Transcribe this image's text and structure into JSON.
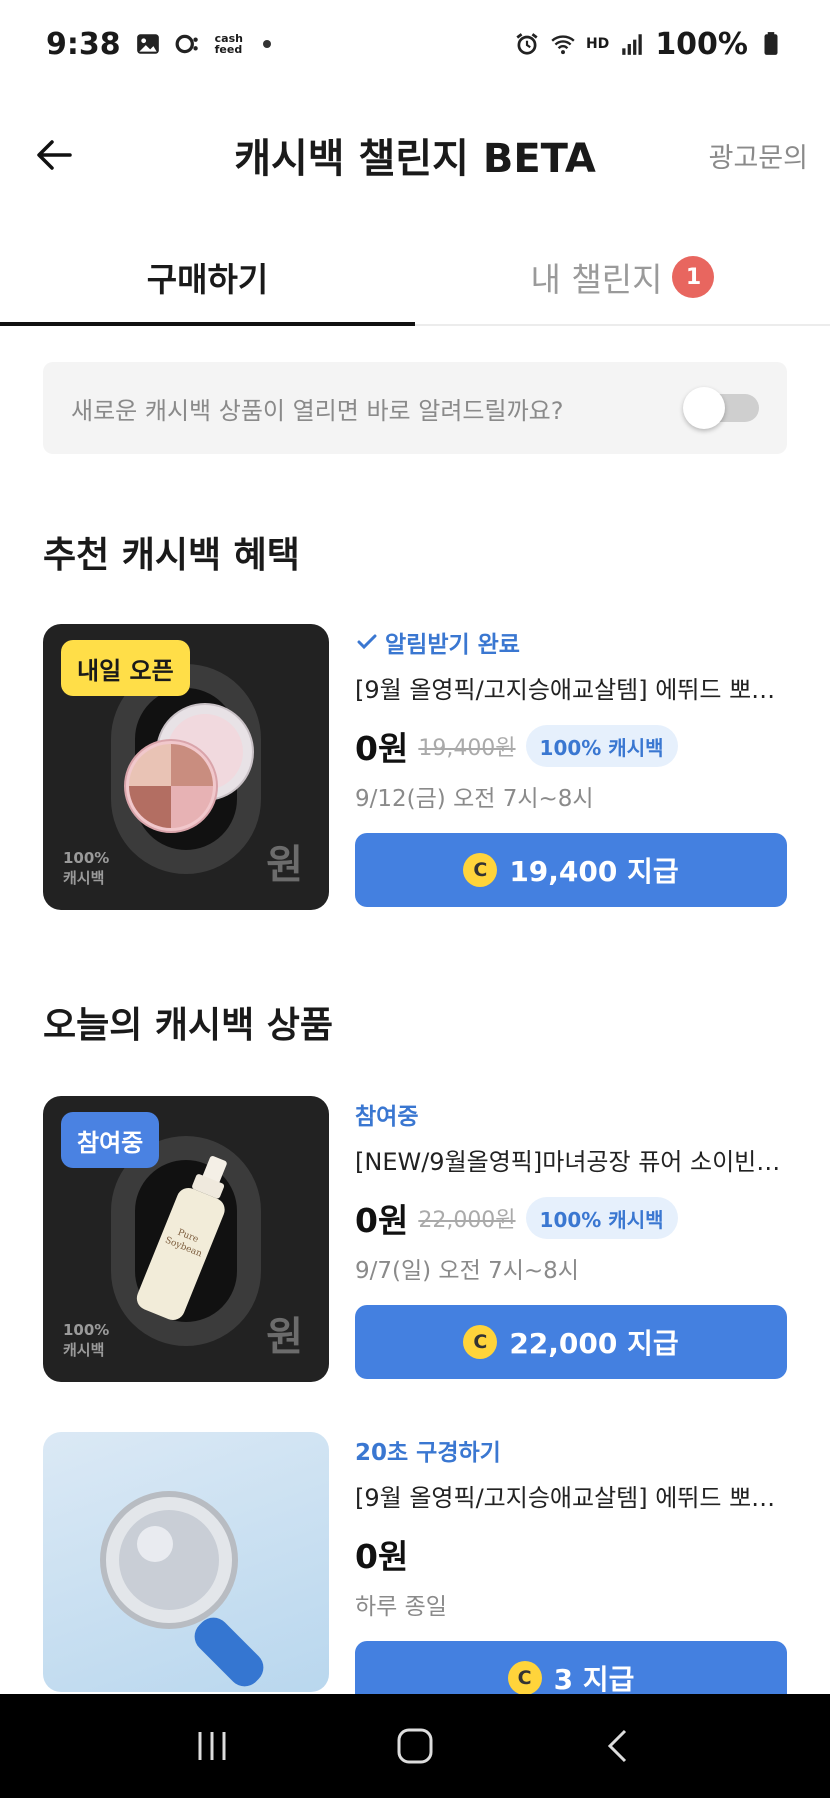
{
  "status_bar": {
    "time": "9:38",
    "cash_label": "cash\nfeed",
    "battery": "100%",
    "hd_label": "HD"
  },
  "header": {
    "title": "캐시백 챌린지 BETA",
    "ad_link": "광고문의"
  },
  "tabs": [
    {
      "label": "구매하기",
      "active": true
    },
    {
      "label": "내 챌린지",
      "badge": "1",
      "active": false
    }
  ],
  "notify": {
    "text": "새로운 캐시백 상품이 열리면 바로 알려드릴까요?",
    "toggle_on": false
  },
  "sections": {
    "recommended": "추천 캐시백 혜택",
    "today": "오늘의 캐시백 상품"
  },
  "products": [
    {
      "thumb_badge": "내일 오픈",
      "thumb_sign": "100%\n캐시백",
      "thumb_won": "원",
      "status": "알림받기 완료",
      "name": "[9월 올영픽/고지승애교살템] 에뛰드 뽀…",
      "price": "0원",
      "original_price": "19,400원",
      "cashback_tag": "100% 캐시백",
      "time": "9/12(금) 오전 7시~8시",
      "button": "19,400 지급",
      "coin": "C"
    },
    {
      "thumb_badge": "참여중",
      "thumb_sign": "100%\n캐시백",
      "thumb_won": "원",
      "status": "참여중",
      "name": "[NEW/9월올영픽]마녀공장 퓨어 소이빈…",
      "price": "0원",
      "original_price": "22,000원",
      "cashback_tag": "100% 캐시백",
      "time": "9/7(일) 오전 7시~8시",
      "button": "22,000 지급",
      "coin": "C"
    },
    {
      "status": "20초 구경하기",
      "name": "[9월 올영픽/고지승애교살템] 에뛰드 뽀…",
      "price": "0원",
      "time": "하루 종일",
      "button": "3 지급",
      "coin": "C"
    }
  ],
  "colors": {
    "accent": "#4480e0",
    "badge_red": "#e8665f",
    "coin_yellow": "#ffd43b",
    "tag_bg": "#e6f0fc"
  }
}
